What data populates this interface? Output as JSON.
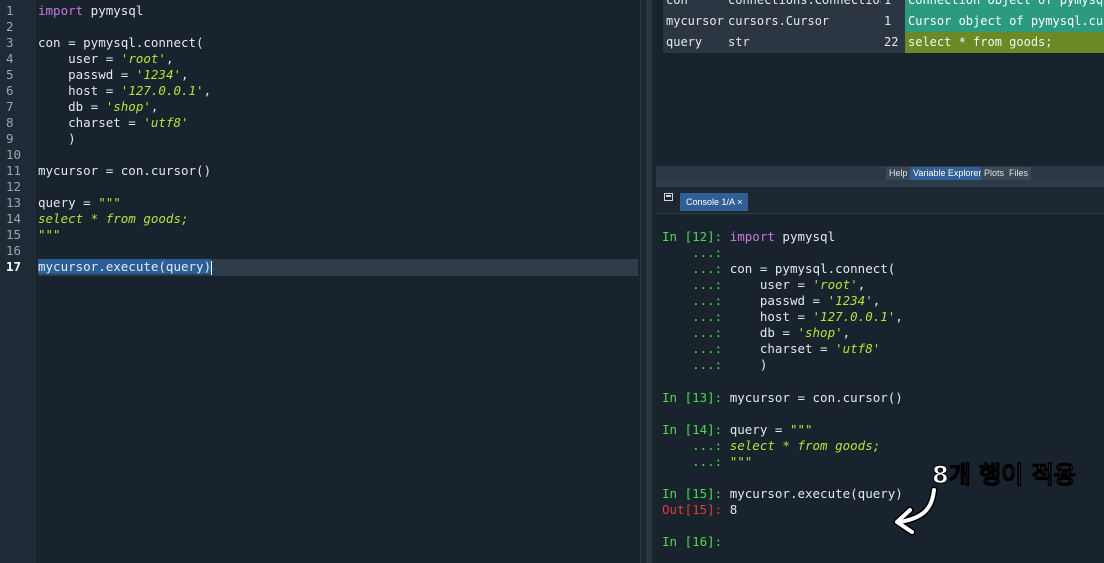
{
  "editor": {
    "line_numbers": [
      "1",
      "2",
      "3",
      "4",
      "5",
      "6",
      "7",
      "8",
      "9",
      "10",
      "11",
      "12",
      "13",
      "14",
      "15",
      "16",
      "17"
    ],
    "current_line": "17",
    "code": {
      "l1_kw": "import",
      "l1_rest": " pymysql",
      "l3": "con = pymysql.connect(",
      "l4_a": "    user = ",
      "l4_s": "'root'",
      "l4_b": ",",
      "l5_a": "    passwd = ",
      "l5_s": "'1234'",
      "l5_b": ",",
      "l6_a": "    host = ",
      "l6_s": "'127.0.0.1'",
      "l6_b": ",",
      "l7_a": "    db = ",
      "l7_s": "'shop'",
      "l7_b": ",",
      "l8_a": "    charset = ",
      "l8_s": "'utf8'",
      "l9": "    )",
      "l11": "mycursor = con.cursor()",
      "l13_a": "query = ",
      "l13_s": "\"\"\"",
      "l14": "select * from goods;",
      "l15": "\"\"\"",
      "l17": "mycursor.execute(query)"
    }
  },
  "variable_explorer": {
    "rows": [
      {
        "name": "con",
        "type": "connections.Connection",
        "size": "1",
        "value": "Connection object of pymysql.c"
      },
      {
        "name": "mycursor",
        "type": "cursors.Cursor",
        "size": "1",
        "value": "Cursor object of pymysql.curso"
      },
      {
        "name": "query",
        "type": "str",
        "size": "22",
        "value": "select * from goods;"
      }
    ],
    "tabs": [
      "Help",
      "Variable Explorer",
      "Plots",
      "Files"
    ],
    "active_tab": "Variable Explorer"
  },
  "console": {
    "tab_label": "Console 1/A",
    "tab_close": "×",
    "lines": {
      "p12": "In [12]: ",
      "p12_kw": "import",
      "p12_rest": " pymysql",
      "c1": "    ...:",
      "c2_p": "    ...: ",
      "c2": "con = pymysql.connect(",
      "c3_p": "    ...: ",
      "c3_a": "    user = ",
      "c3_s": "'root'",
      "c3_b": ",",
      "c4_p": "    ...: ",
      "c4_a": "    passwd = ",
      "c4_s": "'1234'",
      "c4_b": ",",
      "c5_p": "    ...: ",
      "c5_a": "    host = ",
      "c5_s": "'127.0.0.1'",
      "c5_b": ",",
      "c6_p": "    ...: ",
      "c6_a": "    db = ",
      "c6_s": "'shop'",
      "c6_b": ",",
      "c7_p": "    ...: ",
      "c7_a": "    charset = ",
      "c7_s": "'utf8'",
      "c8_p": "    ...: ",
      "c8": "    )",
      "p13": "In [13]: ",
      "p13_code": "mycursor = con.cursor()",
      "p14": "In [14]: ",
      "p14_a": "query = ",
      "p14_s": "\"\"\"",
      "c9_p": "    ...: ",
      "c9": "select * from goods;",
      "c10_p": "    ...: ",
      "c10": "\"\"\"",
      "p15": "In [15]: ",
      "p15_code": "mycursor.execute(query)",
      "out15": "Out[15]: ",
      "out15_val": "8",
      "p16": "In [16]: "
    }
  },
  "annotation": {
    "text": "8개 행이 적용"
  },
  "colors": {
    "background": "#19232d",
    "keyword": "#c678dd",
    "string": "#b5e53c",
    "prompt_in": "#4fd84f",
    "prompt_out": "#e03b3b",
    "value_highlight_green": "#2b9a7d",
    "value_highlight_olive": "#6b8a25",
    "tab_active": "#2f5f95"
  }
}
